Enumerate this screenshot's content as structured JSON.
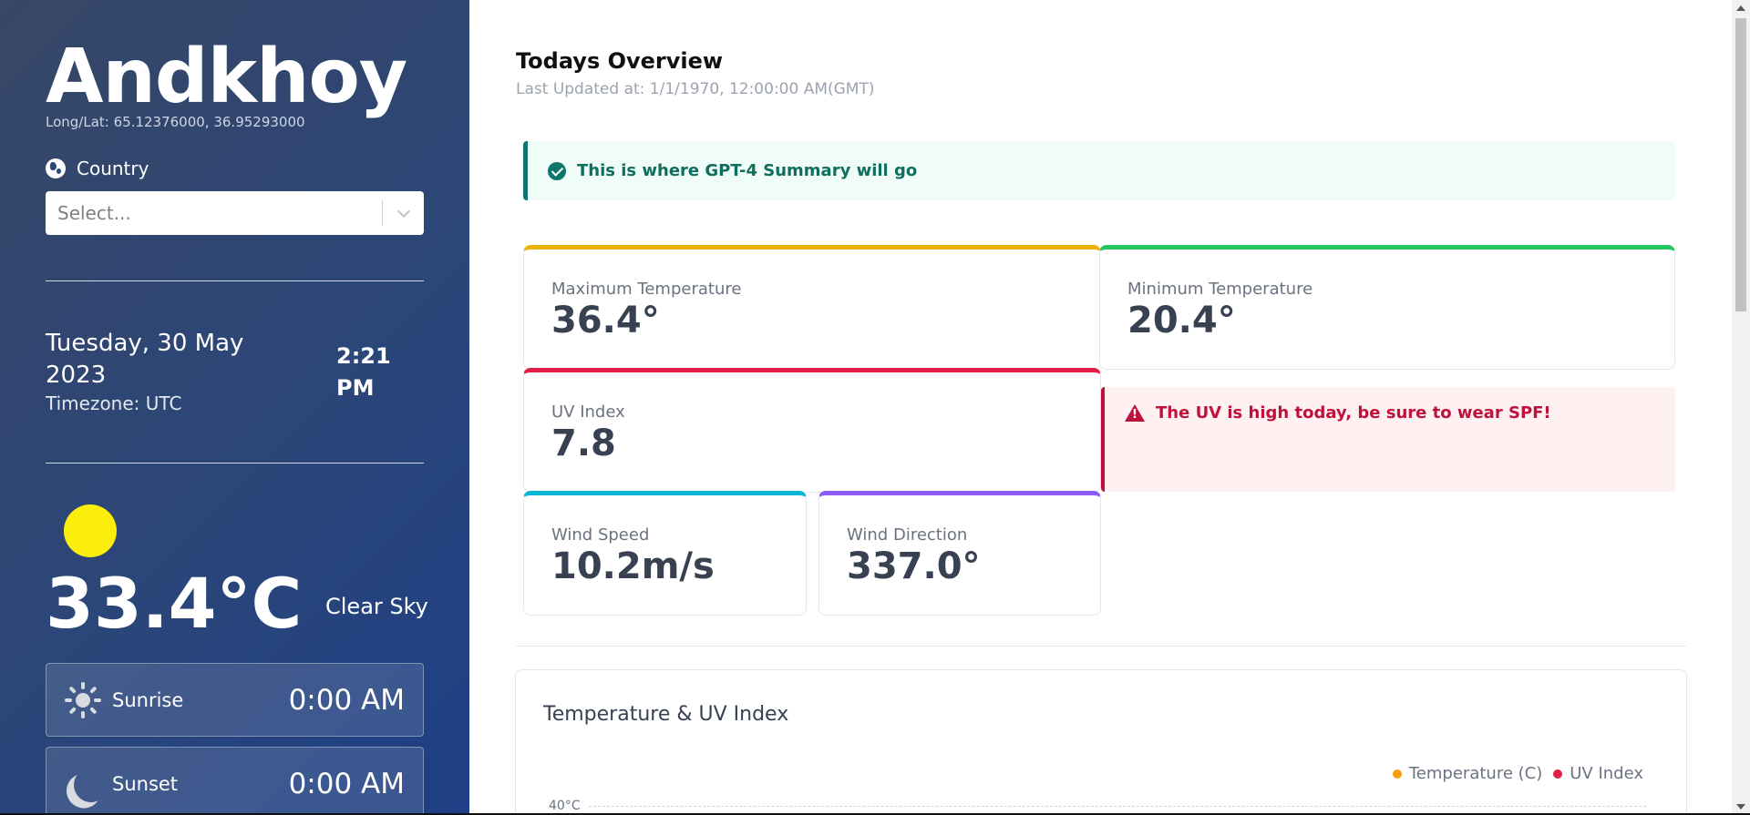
{
  "sidebar": {
    "city": "Andkhoy",
    "coords": "Long/Lat: 65.12376000, 36.95293000",
    "country_label": "Country",
    "select_placeholder": "Select...",
    "date": "Tuesday, 30 May 2023",
    "timezone": "Timezone: UTC",
    "time": "2:21 PM",
    "temperature": "33.4°C",
    "condition": "Clear Sky",
    "sunrise": {
      "label": "Sunrise",
      "value": "0:00 AM"
    },
    "sunset": {
      "label": "Sunset",
      "value": "0:00 AM"
    }
  },
  "main": {
    "title": "Todays Overview",
    "updated": "Last Updated at: 1/1/1970, 12:00:00 AM(GMT)",
    "summary": "This is where GPT-4 Summary will go",
    "stats": {
      "max_temp": {
        "label": "Maximum Temperature",
        "value": "36.4°",
        "color": "#eab308"
      },
      "min_temp": {
        "label": "Minimum Temperature",
        "value": "20.4°",
        "color": "#22c55e"
      },
      "uv": {
        "label": "UV Index",
        "value": "7.8",
        "color": "#e11d48"
      },
      "wind_speed": {
        "label": "Wind Speed",
        "value": "10.2m/s",
        "color": "#06b6d4"
      },
      "wind_dir": {
        "label": "Wind Direction",
        "value": "337.0°",
        "color": "#8b5cf6"
      }
    },
    "uv_alert": "The UV is high today, be sure to wear SPF!",
    "chart": {
      "title": "Temperature & UV Index",
      "legend": [
        {
          "name": "Temperature (C)",
          "color": "#f59e0b"
        },
        {
          "name": "UV Index",
          "color": "#e11d48"
        }
      ],
      "ytick_top": "40°C"
    }
  }
}
